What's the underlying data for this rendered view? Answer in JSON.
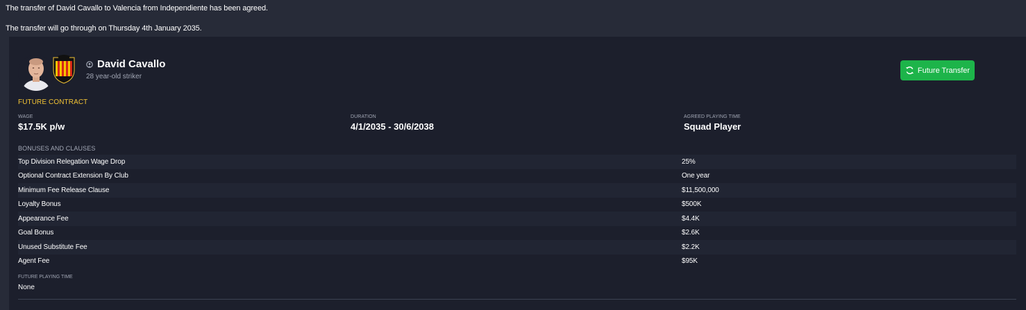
{
  "messages": {
    "line1": "The transfer of David Cavallo to Valencia from Independiente has been agreed.",
    "line2": "The transfer will go through on Thursday 4th January 2035."
  },
  "player": {
    "name": "David Cavallo",
    "subtitle": "28 year-old striker",
    "avatar_icon": "player-face-icon",
    "club_crest_icon": "valencia-crest-icon",
    "status_icon": "player-status-icon"
  },
  "actions": {
    "future_transfer_label": "Future Transfer",
    "future_transfer_icon": "refresh-icon"
  },
  "contract": {
    "section_title": "FUTURE CONTRACT",
    "wage_label": "WAGE",
    "wage_value": "$17.5K p/w",
    "duration_label": "DURATION",
    "duration_value": "4/1/2035 - 30/6/2038",
    "playing_time_label": "AGREED PLAYING TIME",
    "playing_time_value": "Squad Player"
  },
  "bonuses": {
    "section_title": "BONUSES AND CLAUSES",
    "rows": [
      {
        "label": "Top Division Relegation Wage Drop",
        "value": "25%"
      },
      {
        "label": "Optional Contract Extension By Club",
        "value": "One year"
      },
      {
        "label": "Minimum Fee Release Clause",
        "value": "$11,500,000"
      },
      {
        "label": "Loyalty Bonus",
        "value": "$500K"
      },
      {
        "label": "Appearance Fee",
        "value": "$4.4K"
      },
      {
        "label": "Goal Bonus",
        "value": "$2.6K"
      },
      {
        "label": "Unused Substitute Fee",
        "value": "$2.2K"
      },
      {
        "label": "Agent Fee",
        "value": "$95K"
      }
    ]
  },
  "future_playing_time": {
    "label": "FUTURE PLAYING TIME",
    "value": "None"
  },
  "colors": {
    "background": "#272b38",
    "panel": "#1c1f2c",
    "accent_yellow": "#f2c335",
    "button_green": "#1db44a",
    "muted_text": "#a2a7b5"
  }
}
